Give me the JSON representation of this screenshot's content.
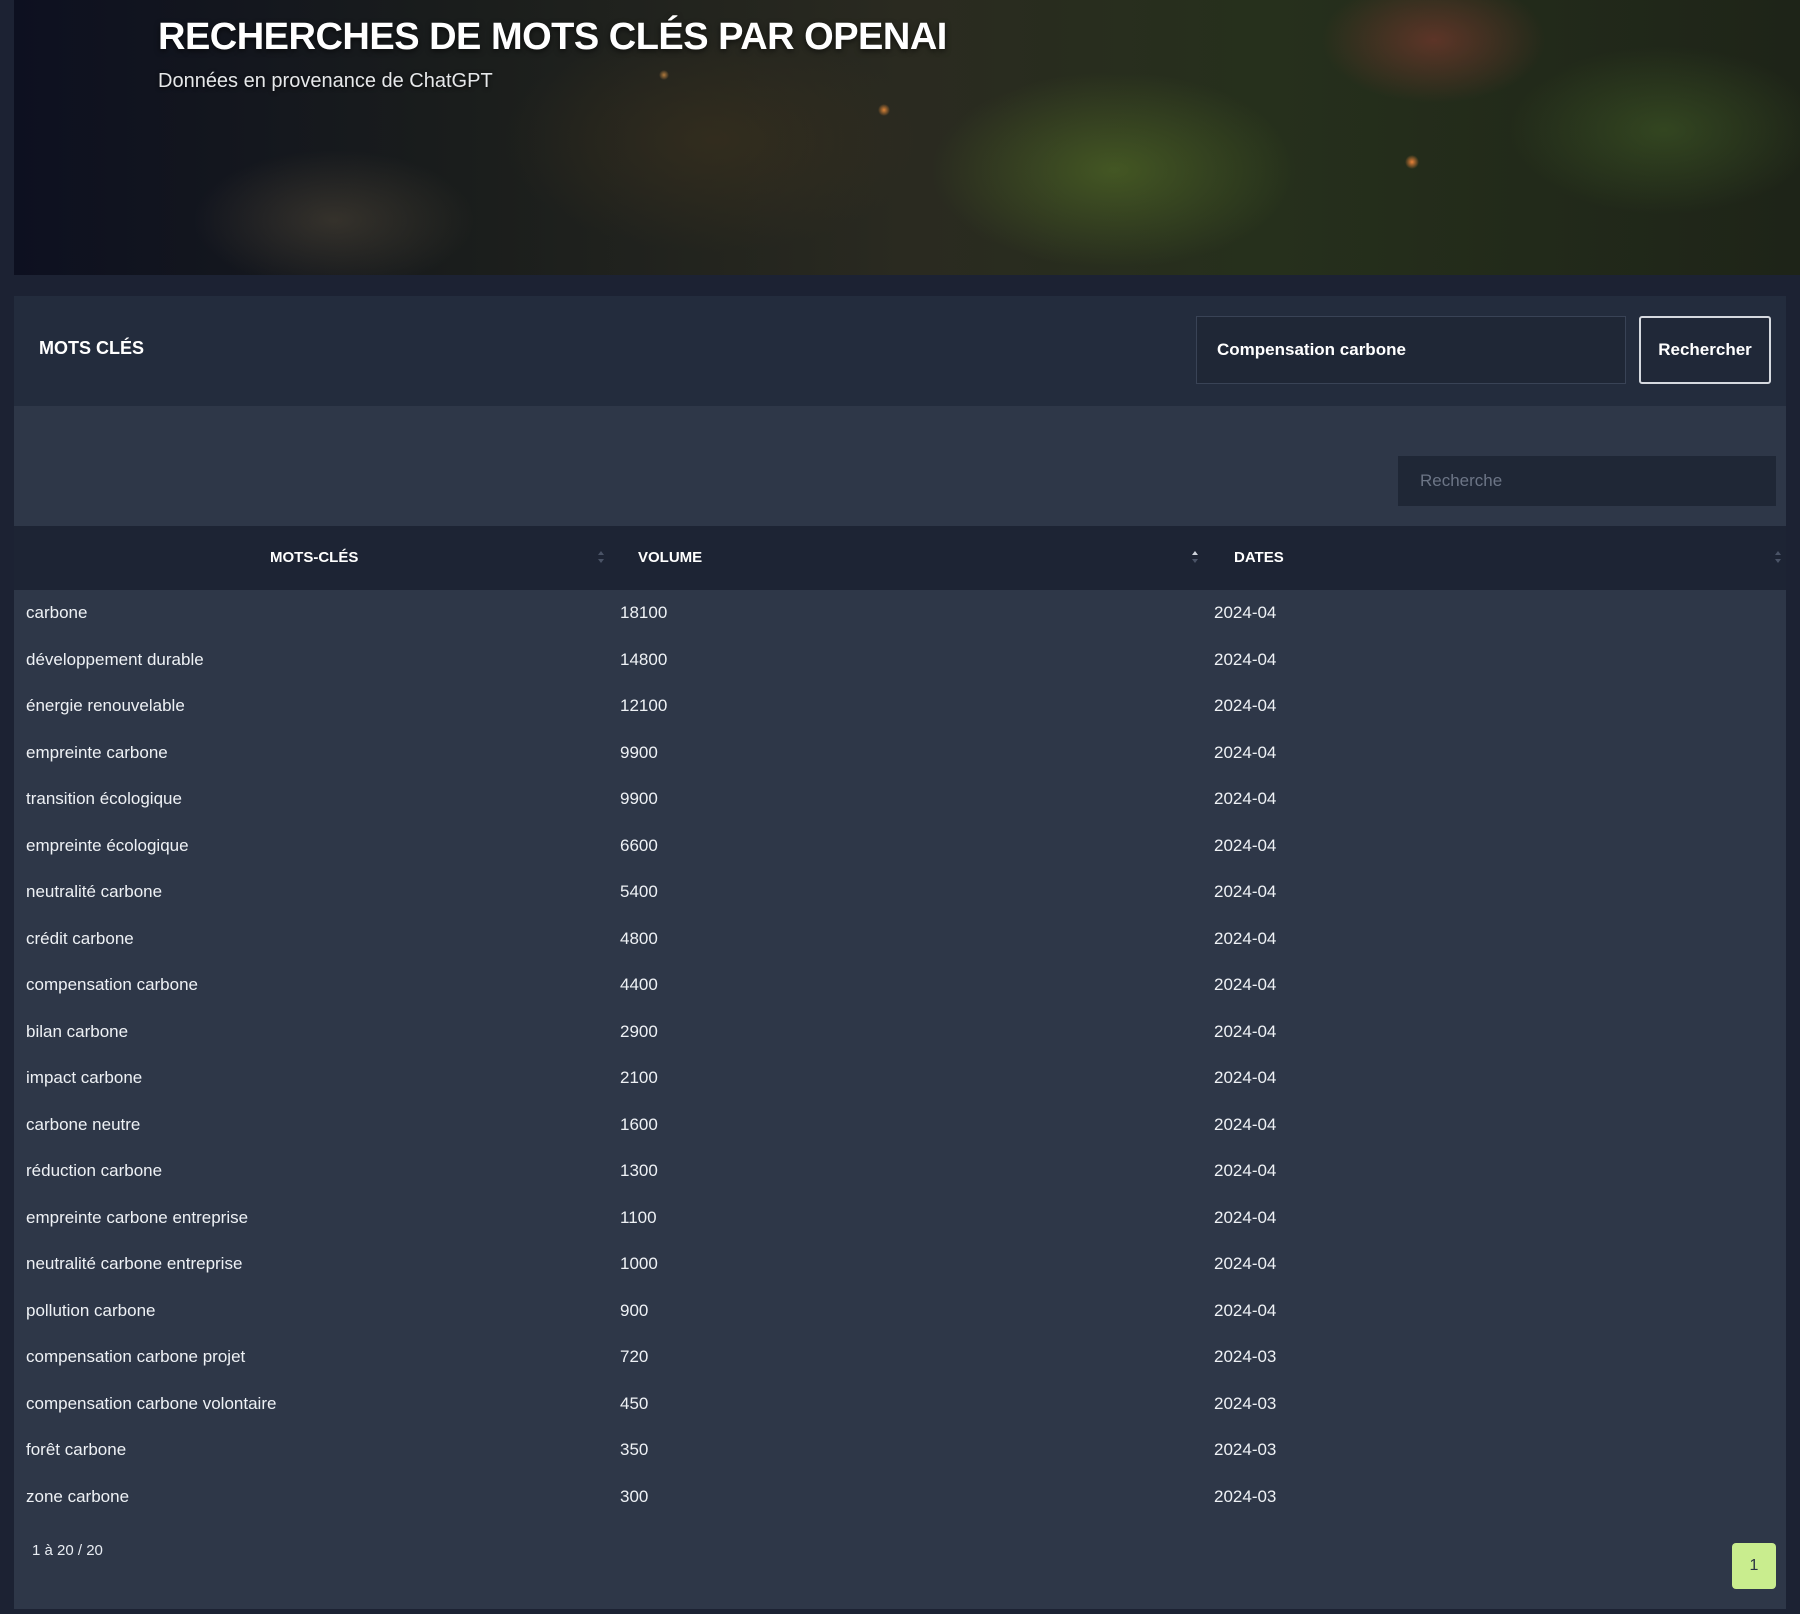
{
  "hero": {
    "title": "RECHERCHES DE MOTS CLÉS PAR OPENAI",
    "subtitle": "Données en provenance de ChatGPT"
  },
  "panel": {
    "title": "MOTS CLÉS",
    "keyword_value": "Compensation carbone",
    "search_button": "Rechercher"
  },
  "table": {
    "filter_placeholder": "Recherche",
    "columns": [
      "MOTS-CLÉS",
      "VOLUME",
      "DATES"
    ],
    "sorted_column": "VOLUME",
    "rows": [
      {
        "keyword": "carbone",
        "volume": "18100",
        "date": "2024-04"
      },
      {
        "keyword": "développement durable",
        "volume": "14800",
        "date": "2024-04"
      },
      {
        "keyword": "énergie renouvelable",
        "volume": "12100",
        "date": "2024-04"
      },
      {
        "keyword": "empreinte carbone",
        "volume": "9900",
        "date": "2024-04"
      },
      {
        "keyword": "transition écologique",
        "volume": "9900",
        "date": "2024-04"
      },
      {
        "keyword": "empreinte écologique",
        "volume": "6600",
        "date": "2024-04"
      },
      {
        "keyword": "neutralité carbone",
        "volume": "5400",
        "date": "2024-04"
      },
      {
        "keyword": "crédit carbone",
        "volume": "4800",
        "date": "2024-04"
      },
      {
        "keyword": "compensation carbone",
        "volume": "4400",
        "date": "2024-04"
      },
      {
        "keyword": "bilan carbone",
        "volume": "2900",
        "date": "2024-04"
      },
      {
        "keyword": "impact carbone",
        "volume": "2100",
        "date": "2024-04"
      },
      {
        "keyword": "carbone neutre",
        "volume": "1600",
        "date": "2024-04"
      },
      {
        "keyword": "réduction carbone",
        "volume": "1300",
        "date": "2024-04"
      },
      {
        "keyword": "empreinte carbone entreprise",
        "volume": "1100",
        "date": "2024-04"
      },
      {
        "keyword": "neutralité carbone entreprise",
        "volume": "1000",
        "date": "2024-04"
      },
      {
        "keyword": "pollution carbone",
        "volume": "900",
        "date": "2024-04"
      },
      {
        "keyword": "compensation carbone projet",
        "volume": "720",
        "date": "2024-03"
      },
      {
        "keyword": "compensation carbone volontaire",
        "volume": "450",
        "date": "2024-03"
      },
      {
        "keyword": "forêt carbone",
        "volume": "350",
        "date": "2024-03"
      },
      {
        "keyword": "zone carbone",
        "volume": "300",
        "date": "2024-03"
      }
    ],
    "info": "1 à 20 / 20",
    "current_page": "1"
  },
  "colors": {
    "page_bg": "#1c2233",
    "card_bg": "#2e3748",
    "header_bg": "#1d2434",
    "active_page": "#c9ed8e"
  }
}
